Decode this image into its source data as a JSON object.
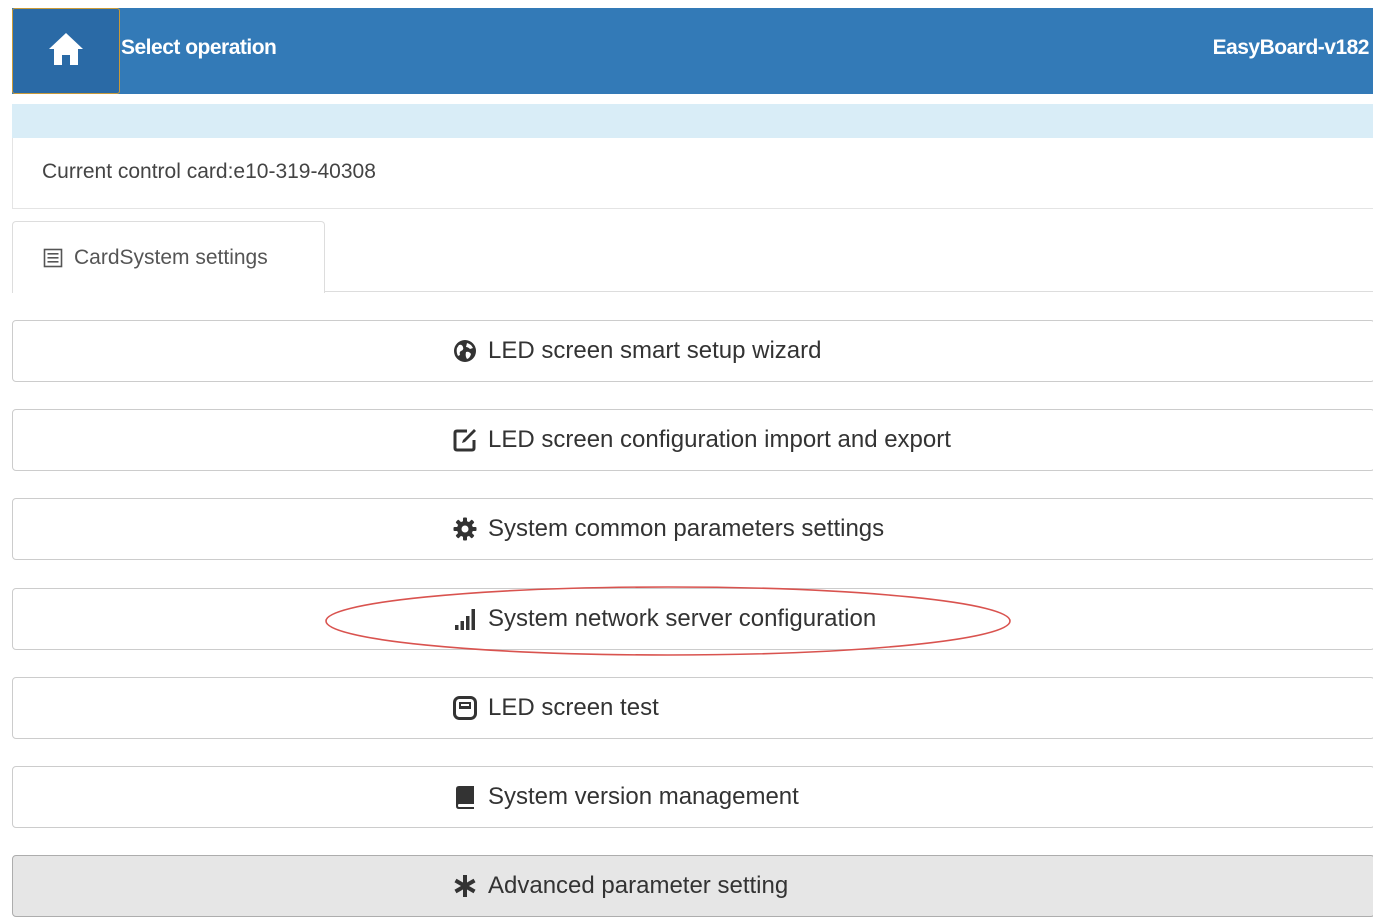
{
  "header": {
    "title": "Select operation",
    "version": "EasyBoard-v182",
    "home_icon": "home-icon",
    "background_color": "#337ab7"
  },
  "card_info": {
    "text": "Current control card:e10-319-40308"
  },
  "tab": {
    "label": "CardSystem settings",
    "icon": "list-icon"
  },
  "menu": [
    {
      "label": "LED screen smart setup wizard",
      "icon": "globe-icon"
    },
    {
      "label": "LED screen configuration import and export",
      "icon": "edit-icon"
    },
    {
      "label": "System common parameters settings",
      "icon": "gear-icon"
    },
    {
      "label": "System network server configuration",
      "icon": "signal-icon",
      "highlighted": true
    },
    {
      "label": "LED screen test",
      "icon": "screen-icon"
    },
    {
      "label": "System version management",
      "icon": "book-icon"
    },
    {
      "label": "Advanced parameter setting",
      "icon": "asterisk-icon",
      "active": true
    }
  ],
  "annotation_color": "#d9534f"
}
